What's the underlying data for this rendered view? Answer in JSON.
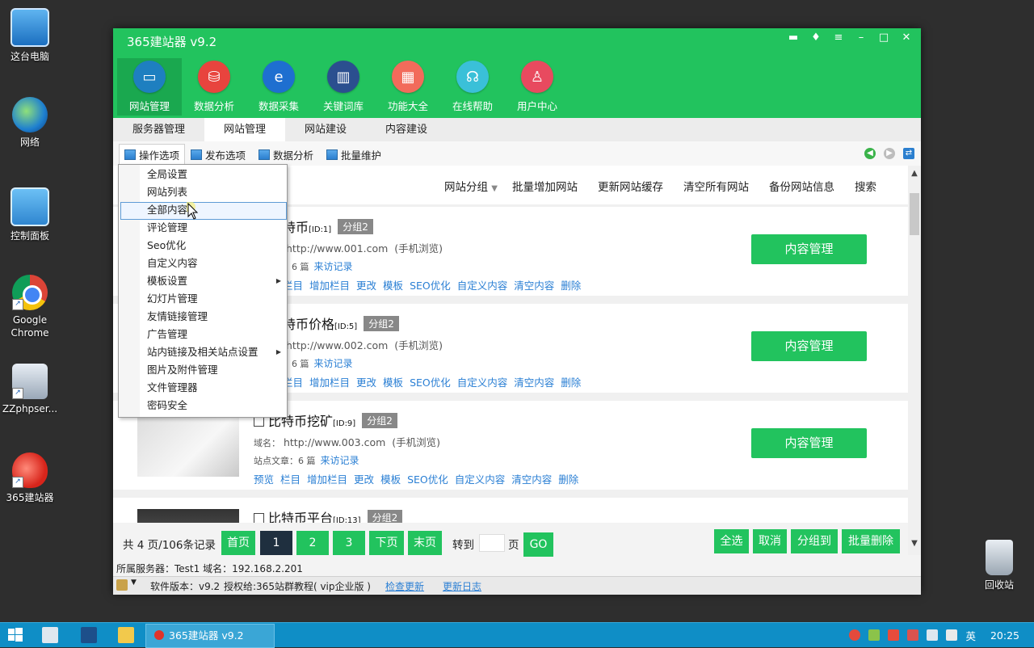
{
  "desktop": {
    "icons": [
      {
        "label": "这台电脑"
      },
      {
        "label": "网络"
      },
      {
        "label": "控制面板"
      },
      {
        "label": "Google Chrome"
      },
      {
        "label": "ZZphpser..."
      },
      {
        "label": "365建站器"
      },
      {
        "label": "回收站"
      }
    ]
  },
  "app": {
    "title": "365建站器 v9.2",
    "nav": [
      {
        "label": "网站管理",
        "color": "#1e7fc0"
      },
      {
        "label": "数据分析",
        "color": "#e8443e"
      },
      {
        "label": "数据采集",
        "color": "#1e6fd0"
      },
      {
        "label": "关键词库",
        "color": "#2b4f8f"
      },
      {
        "label": "功能大全",
        "color": "#f26b5b"
      },
      {
        "label": "在线帮助",
        "color": "#3ac0d8"
      },
      {
        "label": "用户中心",
        "color": "#e84a5f"
      }
    ],
    "tabs": [
      "服务器管理",
      "网站管理",
      "网站建设",
      "内容建设"
    ],
    "subtabs": [
      "操作选项",
      "发布选项",
      "数据分析",
      "批量维护"
    ],
    "toolbar": [
      "网站分组",
      "批量增加网站",
      "更新网站缓存",
      "清空所有网站",
      "备份网站信息",
      "搜索"
    ],
    "menu": [
      {
        "label": "全局设置"
      },
      {
        "label": "网站列表"
      },
      {
        "label": "全部内容"
      },
      {
        "label": "评论管理"
      },
      {
        "label": "Seo优化"
      },
      {
        "label": "自定义内容"
      },
      {
        "label": "模板设置",
        "submenu": true
      },
      {
        "label": "幻灯片管理"
      },
      {
        "label": "友情链接管理"
      },
      {
        "label": "广告管理"
      },
      {
        "label": "站内链接及相关站点设置",
        "submenu": true
      },
      {
        "label": "图片及附件管理"
      },
      {
        "label": "文件管理器"
      },
      {
        "label": "密码安全"
      }
    ],
    "sites": [
      {
        "title_prefix": "特币",
        "id": "[ID:1]",
        "group": "分组2",
        "url_label": "",
        "url": "http://www.001.com",
        "mobile": "(手机浏览)",
        "stat_label": "：6 篇",
        "visit": "来访记录",
        "links": [
          "栏目",
          "增加栏目",
          "更改",
          "模板",
          "SEO优化",
          "自定义内容",
          "清空内容",
          "删除"
        ],
        "button": "内容管理"
      },
      {
        "title_prefix": "特币价格",
        "id": "[ID:5]",
        "group": "分组2",
        "url_label": "",
        "url": "http://www.002.com",
        "mobile": "(手机浏览)",
        "stat_label": "：6 篇",
        "visit": "来访记录",
        "links": [
          "栏目",
          "增加栏目",
          "更改",
          "模板",
          "SEO优化",
          "自定义内容",
          "清空内容",
          "删除"
        ],
        "button": "内容管理"
      },
      {
        "title_prefix": "比特币挖矿",
        "id": "[ID:9]",
        "group": "分组2",
        "url_label": "域名：",
        "url": "http://www.003.com",
        "mobile": "(手机浏览)",
        "stat_label": "站点文章：6 篇",
        "visit": "来访记录",
        "links": [
          "预览",
          "栏目",
          "增加栏目",
          "更改",
          "模板",
          "SEO优化",
          "自定义内容",
          "清空内容",
          "删除"
        ],
        "button": "内容管理"
      },
      {
        "title_prefix": "比特币平台",
        "id": "[ID:13]",
        "group": "分组2"
      }
    ],
    "pager": {
      "summary": "共 4 页/106条记录",
      "first": "首页",
      "pages": [
        "1",
        "2",
        "3"
      ],
      "next": "下页",
      "last": "末页",
      "goto": "转到",
      "page_unit": "页",
      "go": "GO",
      "select_all": "全选",
      "cancel": "取消",
      "group_to": "分组到",
      "batch_delete": "批量删除"
    },
    "status": "所属服务器：Test1 域名：192.168.2.201",
    "footer": {
      "version": "软件版本：v9.2",
      "license": "授权给:365站群教程( vip企业版 )",
      "check_update": "检查更新",
      "changelog": "更新日志"
    }
  },
  "taskbar": {
    "app_label": "365建站器 v9.2",
    "ime": "英",
    "time": "20:25"
  }
}
